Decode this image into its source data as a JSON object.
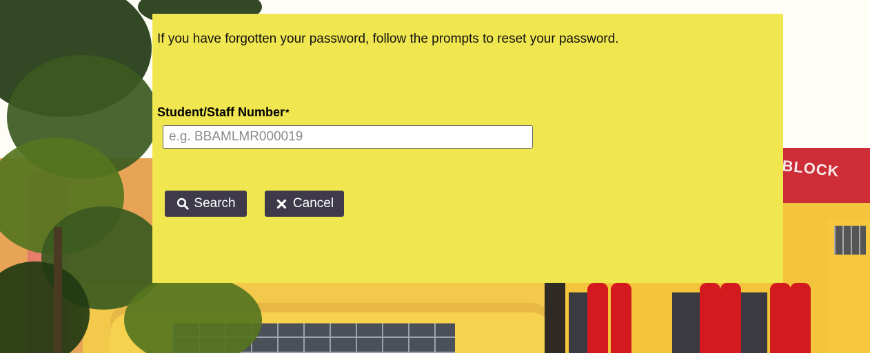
{
  "background": {
    "building_sign": "BLOCK",
    "colors": {
      "wall_yellow": "#f4c53c",
      "pillar_red": "#d31a1f",
      "foliage_green": "#3b5a1f"
    }
  },
  "panel": {
    "background_color": "#f0e64f",
    "intro_text": "If you have forgotten your password, follow the prompts to reset your password.",
    "field_label": "Student/Staff Number",
    "required_marker": "*",
    "input": {
      "value": "",
      "placeholder": "e.g. BBAMLMR000019"
    },
    "buttons": {
      "search": {
        "label": "Search",
        "icon": "search-icon"
      },
      "cancel": {
        "label": "Cancel",
        "icon": "close-icon"
      }
    },
    "button_color": "#3e3a4a"
  }
}
